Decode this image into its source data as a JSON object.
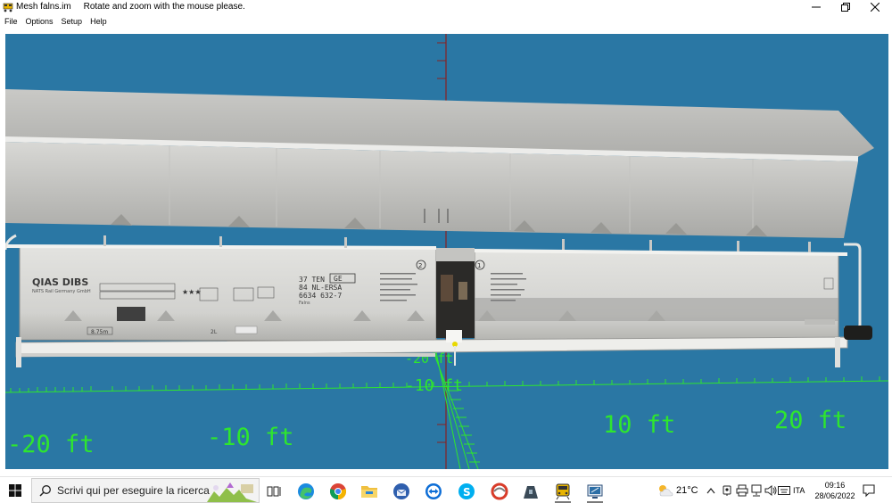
{
  "window": {
    "title": "Mesh falns.im",
    "message": "Rotate and zoom with the mouse please.",
    "app_icon": "wagon-icon",
    "controls": [
      "minimize-icon",
      "maximize-icon",
      "close-icon"
    ]
  },
  "menu": {
    "items": [
      "File",
      "Options",
      "Setup",
      "Help"
    ]
  },
  "viewport": {
    "background_color": "#2a77a4",
    "grid_color": "#2ee62e",
    "axis_color": "#8a2020",
    "axis_labels": {
      "neg20": "-20 ft",
      "neg10": "-10 ft",
      "pos10": "10 ft",
      "pos20": "20 ft",
      "vert_neg20": "-20 ft",
      "vert_neg10": "-10 ft"
    },
    "wagon": {
      "operator": "QIAS DIBS",
      "operator_sub": "NATS Rail Germany GmbH",
      "code1": "37 TEN",
      "code1_box": "GE",
      "code2": "84 NL-ERSA",
      "code3": "6634 632-7",
      "code4": "Falns",
      "length": "8.75m",
      "marker_left": "2",
      "marker_right": "1",
      "small_label": "2L"
    }
  },
  "taskbar": {
    "search_placeholder": "Scrivi qui per eseguire la ricerca",
    "apps": [
      "task-view-icon",
      "edge-icon",
      "chrome-icon",
      "file-explorer-icon",
      "thunderbird-icon",
      "teamviewer-icon",
      "skype-icon",
      "ccleaner-icon",
      "terminal-icon",
      "train-icon",
      "mesh-viewer-icon"
    ],
    "weather": {
      "icon": "partly-cloudy-icon",
      "temperature": "21°C"
    },
    "tray_icons": [
      "chevron-up-icon",
      "meet-now-icon",
      "printer-icon",
      "network-icon",
      "volume-icon",
      "keyboard-icon"
    ],
    "language": "ITA",
    "time": "09:16",
    "date": "28/06/2022",
    "notification_icon": "notification-icon"
  }
}
